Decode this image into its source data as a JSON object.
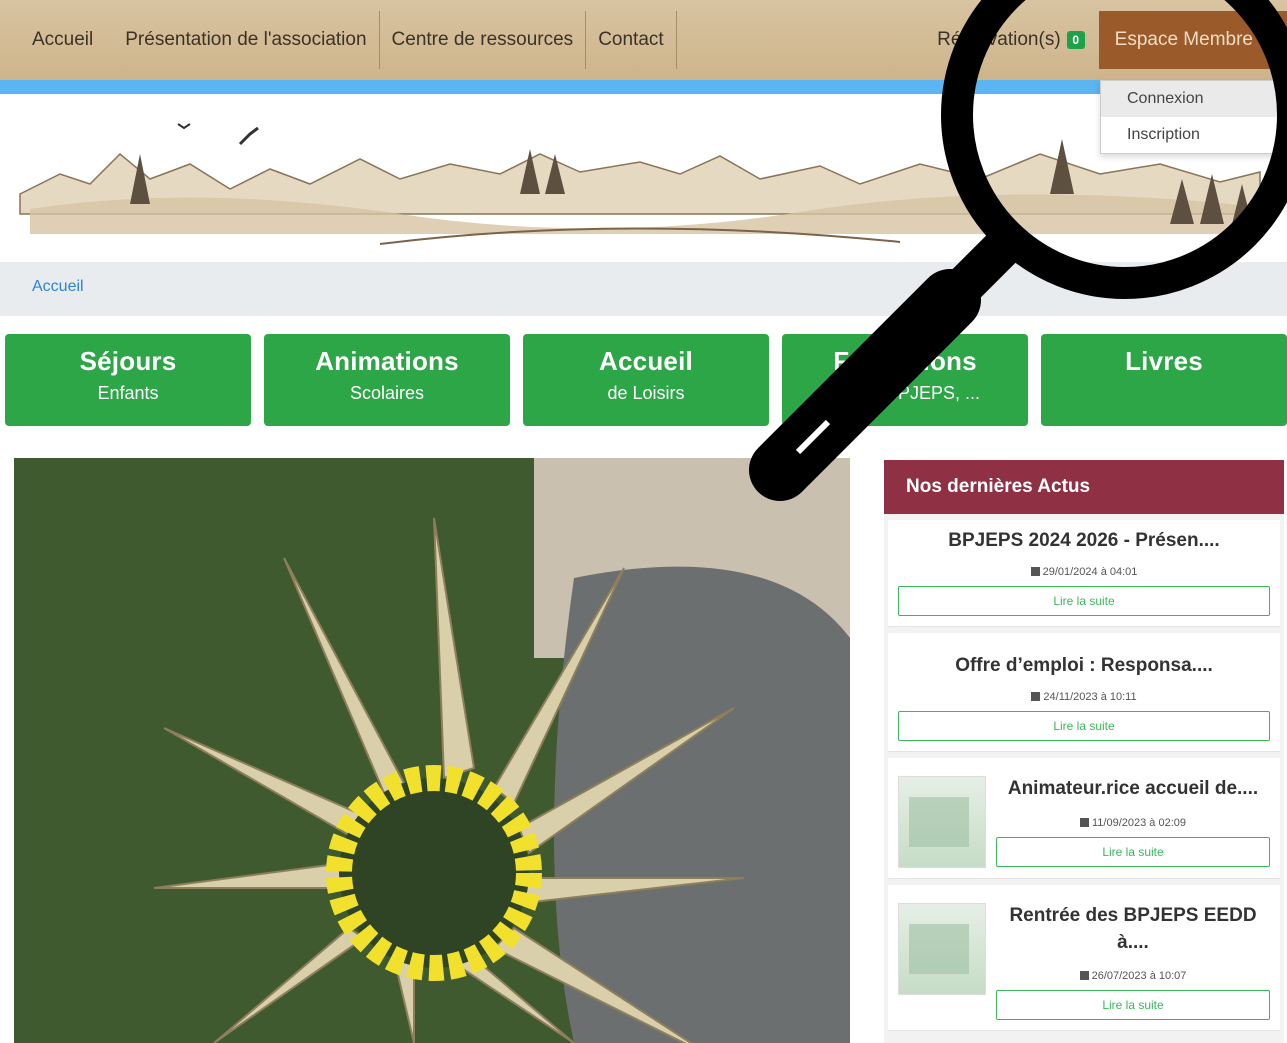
{
  "nav": {
    "items": [
      "Accueil",
      "Présentation de l'association",
      "Centre de ressources",
      "Contact"
    ],
    "reservations_label": "Réservation(s)",
    "reservations_count": "0",
    "member_label": "Espace Membre"
  },
  "dropdown": {
    "items": [
      "Connexion",
      "Inscription"
    ]
  },
  "breadcrumb": {
    "home": "Accueil"
  },
  "tiles": [
    {
      "title": "Séjours",
      "subtitle": "Enfants"
    },
    {
      "title": "Animations",
      "subtitle": "Scolaires"
    },
    {
      "title": "Accueil",
      "subtitle": "de Loisirs"
    },
    {
      "title": "Formations",
      "subtitle": "BAFA, BPJEPS, ..."
    },
    {
      "title": "Livres",
      "subtitle": ""
    }
  ],
  "news": {
    "heading": "Nos dernières Actus",
    "read_more": "Lire la suite",
    "items": [
      {
        "title": "BPJEPS 2024 2026 - Présen....",
        "date": "29/01/2024 à 04:01",
        "thumb": false
      },
      {
        "title": "Offre d’emploi : Responsa....",
        "date": "24/11/2023 à 10:11",
        "thumb": false
      },
      {
        "title": "Animateur.rice accueil de....",
        "date": "11/09/2023 à 02:09",
        "thumb": true
      },
      {
        "title": "Rentrée des BPJEPS EEDD à....",
        "date": "26/07/2023 à 10:07",
        "thumb": true
      }
    ]
  },
  "colors": {
    "nav_bg": "#d2bc96",
    "member_bg": "#9a5a2a",
    "tile_green": "#2ca646",
    "news_head": "#8f3044",
    "link_blue": "#2b82d9"
  },
  "icons": [
    "magnifier-icon",
    "calendar-icon",
    "caret-down-icon"
  ]
}
